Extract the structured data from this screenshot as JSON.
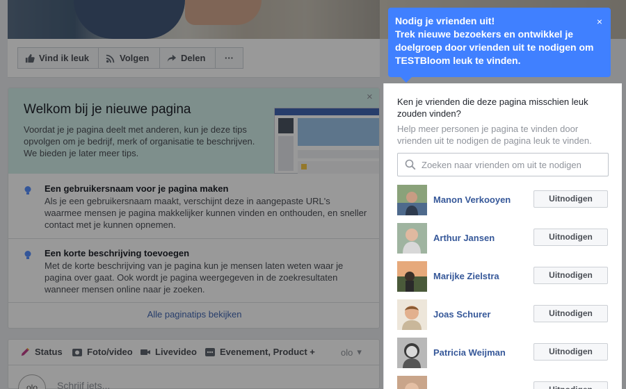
{
  "page_actions": {
    "like": "Vind ik leuk",
    "follow": "Volgen",
    "share": "Delen",
    "more": "···"
  },
  "welcome": {
    "title": "Welkom bij je nieuwe pagina",
    "description": "Voordat je je pagina deelt met anderen, kun je deze tips opvolgen om je bedrijf, merk of organisatie te beschrijven. We bieden je later meer tips.",
    "close": "×",
    "tips": [
      {
        "title": "Een gebruikersnaam voor je pagina maken",
        "text": "Als je een gebruikersnaam maakt, verschijnt deze in aangepaste URL's waarmee mensen je pagina makkelijker kunnen vinden en onthouden, en sneller contact met je kunnen opnemen."
      },
      {
        "title": "Een korte beschrijving toevoegen",
        "text": "Met de korte beschrijving van je pagina kun je mensen laten weten waar je pagina over gaat. Ook wordt je pagina weergegeven in de zoekresultaten wanneer mensen online naar je zoeken."
      }
    ],
    "all_tips": "Alle paginatips bekijken"
  },
  "composer": {
    "tabs": [
      "Status",
      "Foto/video",
      "Livevideo",
      "Evenement, Product +"
    ],
    "extra": "olo",
    "placeholder": "Schrijf iets..."
  },
  "tooltip": {
    "title": "Nodig je vrienden uit!",
    "text": "Trek nieuwe bezoekers en ontwikkel je doelgroep door vrienden uit te nodigen om TESTBloom leuk te vinden.",
    "close": "×"
  },
  "invite_panel": {
    "question": "Ken je vrienden die deze pagina misschien leuk zouden vinden?",
    "subtitle": "Help meer personen je pagina te vinden door vrienden uit te nodigen de pagina leuk te vinden.",
    "search_placeholder": "Zoeken naar vrienden om uit te nodigen",
    "invite_label": "Uitnodigen",
    "friends": [
      {
        "name": "Manon Verkooyen"
      },
      {
        "name": "Arthur Jansen"
      },
      {
        "name": "Marijke Zielstra"
      },
      {
        "name": "Joas Schurer"
      },
      {
        "name": "Patricia Weijman"
      }
    ]
  },
  "colors": {
    "overlay": "rgba(0,0,0,0.4)",
    "tooltip_blue": "#4080ff",
    "link_blue": "#365899",
    "welcome_bg": "#d3eeea"
  }
}
